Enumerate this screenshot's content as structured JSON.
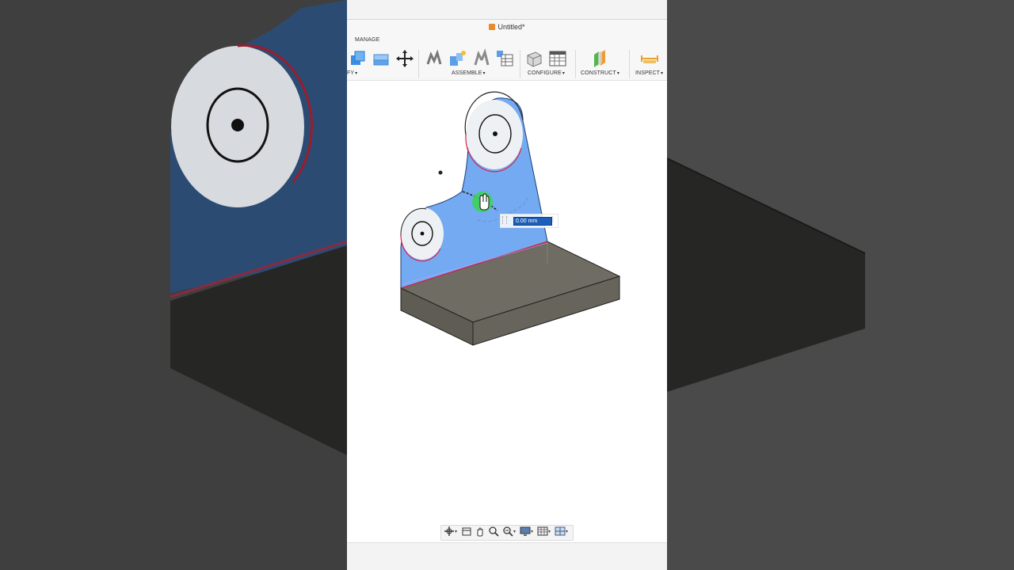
{
  "document": {
    "title": "Untitled*"
  },
  "toolbar": {
    "active_tab": "MANAGE",
    "groups": [
      {
        "label": "FY",
        "caret": "▾"
      },
      {
        "label": "ASSEMBLE",
        "caret": "▾"
      },
      {
        "label": "CONFIGURE",
        "caret": "▾"
      },
      {
        "label": "CONSTRUCT",
        "caret": "▾"
      },
      {
        "label": "INSPECT",
        "caret": "▾"
      }
    ],
    "icons": [
      "combine-icon",
      "replace-face-icon",
      "move-icon",
      "joint-icon",
      "as-built-joint-icon",
      "joint-origin-icon",
      "table-icon",
      "configure-box-icon",
      "configure-table-icon",
      "construct-plane-icon",
      "measure-icon"
    ]
  },
  "dimension": {
    "value": "0.00 mm"
  },
  "colors": {
    "face_blue": "#74aaf2",
    "body_gray": "#6f6c63",
    "selected_edge": "#e0204a",
    "cursor_green": "#3dd35b"
  },
  "navbar": {
    "icons": [
      "orbit-icon",
      "look-at-icon",
      "pan-icon",
      "zoom-icon",
      "zoom-window-icon",
      "display-settings-icon",
      "grid-icon",
      "viewports-icon"
    ]
  }
}
